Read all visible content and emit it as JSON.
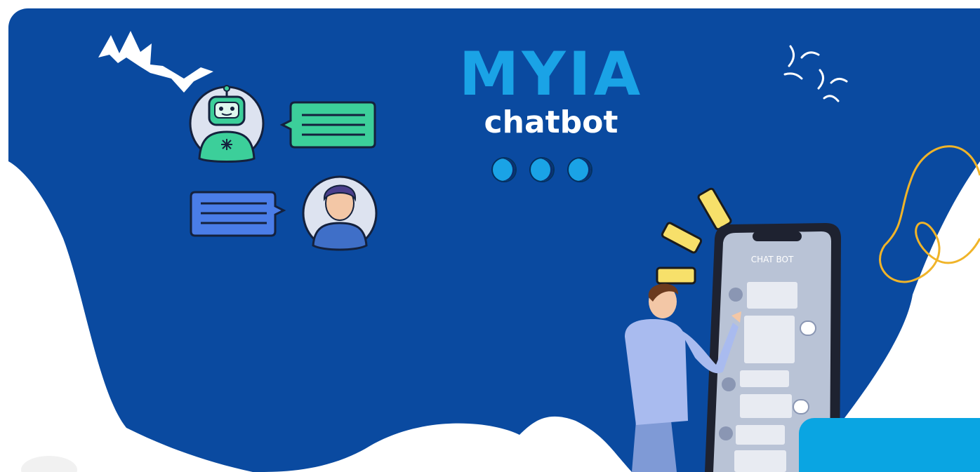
{
  "banner": {
    "brand": "MYIA",
    "subtitle": "chatbot",
    "phone_screen_label": "CHAT BOT"
  },
  "colors": {
    "background_blue": "#0a4aa0",
    "accent_cyan": "#1aa3e6",
    "white": "#ffffff",
    "yellow_line": "#f0b429",
    "bubble_green": "#3ccf9a",
    "bubble_blue": "#4a7de8"
  },
  "icons": [
    "robot-avatar-icon",
    "user-avatar-icon",
    "chat-bubble-icon",
    "smartphone-icon",
    "sparkle-icon"
  ]
}
